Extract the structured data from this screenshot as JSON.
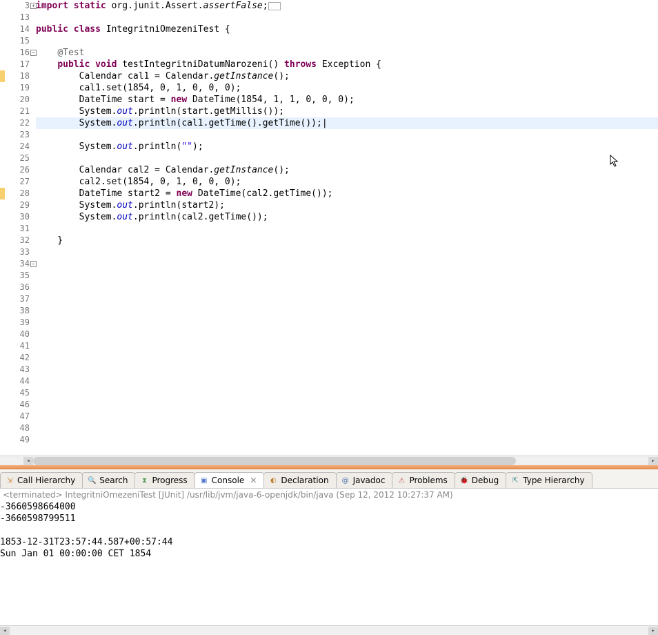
{
  "editor": {
    "lines": [
      {
        "n": "3",
        "fold": "plus",
        "tokens": [
          {
            "t": "import static ",
            "c": "kw"
          },
          {
            "t": "org.junit.Assert."
          },
          {
            "t": "assertFalse",
            "c": "ital"
          },
          {
            "t": ";"
          },
          {
            "t": "[]",
            "c": "hint"
          }
        ]
      },
      {
        "n": "13",
        "tokens": []
      },
      {
        "n": "14",
        "tokens": [
          {
            "t": "public class ",
            "c": "kw"
          },
          {
            "t": "IntegritniOmezeniTest {"
          }
        ]
      },
      {
        "n": "15",
        "tokens": []
      },
      {
        "n": "16",
        "fold": "minus",
        "tokens": [
          {
            "t": "    "
          },
          {
            "t": "@Test",
            "c": "ann"
          }
        ]
      },
      {
        "n": "17",
        "tokens": [
          {
            "t": "    "
          },
          {
            "t": "public void ",
            "c": "kw"
          },
          {
            "t": "testIntegritniDatumNarozeni() "
          },
          {
            "t": "throws ",
            "c": "kw"
          },
          {
            "t": "Exception {"
          }
        ]
      },
      {
        "n": "18",
        "tokens": [
          {
            "t": "        Calendar cal1 = Calendar."
          },
          {
            "t": "getInstance",
            "c": "ital"
          },
          {
            "t": "();"
          }
        ]
      },
      {
        "n": "19",
        "tokens": [
          {
            "t": "        cal1.set(1854, 0, 1, 0, 0, 0);"
          }
        ]
      },
      {
        "n": "20",
        "tokens": [
          {
            "t": "        DateTime start = "
          },
          {
            "t": "new ",
            "c": "kw"
          },
          {
            "t": "DateTime(1854, 1, 1, 0, 0, 0);"
          }
        ]
      },
      {
        "n": "21",
        "tokens": [
          {
            "t": "        System."
          },
          {
            "t": "out",
            "c": "fld"
          },
          {
            "t": ".println(start.getMillis());"
          }
        ]
      },
      {
        "n": "22",
        "hl": true,
        "tokens": [
          {
            "t": "        System."
          },
          {
            "t": "out",
            "c": "fld"
          },
          {
            "t": ".println(cal1.getTime().getTime());"
          },
          {
            "t": "|",
            "c": "cursor"
          }
        ]
      },
      {
        "n": "23",
        "tokens": []
      },
      {
        "n": "24",
        "tokens": [
          {
            "t": "        System."
          },
          {
            "t": "out",
            "c": "fld"
          },
          {
            "t": ".println("
          },
          {
            "t": "\"\"",
            "c": "str"
          },
          {
            "t": ");"
          }
        ]
      },
      {
        "n": "25",
        "tokens": []
      },
      {
        "n": "26",
        "tokens": [
          {
            "t": "        Calendar cal2 = Calendar."
          },
          {
            "t": "getInstance",
            "c": "ital"
          },
          {
            "t": "();"
          }
        ]
      },
      {
        "n": "27",
        "tokens": [
          {
            "t": "        cal2.set(1854, 0, 1, 0, 0, 0);"
          }
        ]
      },
      {
        "n": "28",
        "tokens": [
          {
            "t": "        DateTime start2 = "
          },
          {
            "t": "new ",
            "c": "kw"
          },
          {
            "t": "DateTime(cal2.getTime());"
          }
        ]
      },
      {
        "n": "29",
        "tokens": [
          {
            "t": "        System."
          },
          {
            "t": "out",
            "c": "fld"
          },
          {
            "t": ".println(start2);"
          }
        ]
      },
      {
        "n": "30",
        "tokens": [
          {
            "t": "        System."
          },
          {
            "t": "out",
            "c": "fld"
          },
          {
            "t": ".println(cal2.getTime());"
          }
        ]
      },
      {
        "n": "31",
        "tokens": []
      },
      {
        "n": "32",
        "tokens": [
          {
            "t": "    }"
          }
        ]
      },
      {
        "n": "33",
        "tokens": []
      },
      {
        "n": "34",
        "fold": "minus",
        "tokens": []
      },
      {
        "n": "35",
        "tokens": []
      },
      {
        "n": "36",
        "tokens": []
      },
      {
        "n": "37",
        "tokens": []
      },
      {
        "n": "38",
        "tokens": []
      },
      {
        "n": "39",
        "tokens": []
      },
      {
        "n": "40",
        "tokens": []
      },
      {
        "n": "41",
        "tokens": []
      },
      {
        "n": "42",
        "tokens": []
      },
      {
        "n": "43",
        "tokens": []
      },
      {
        "n": "44",
        "tokens": []
      },
      {
        "n": "45",
        "tokens": []
      },
      {
        "n": "46",
        "tokens": []
      },
      {
        "n": "47",
        "tokens": []
      },
      {
        "n": "48",
        "tokens": []
      },
      {
        "n": "49",
        "tokens": []
      }
    ]
  },
  "tabs": [
    {
      "icon": "hierarchy",
      "color": "#c77d2e",
      "label": "Call Hierarchy"
    },
    {
      "icon": "search",
      "color": "#d9a440",
      "label": "Search"
    },
    {
      "icon": "progress",
      "color": "#5a9e5a",
      "label": "Progress"
    },
    {
      "icon": "console",
      "color": "#5577cc",
      "label": "Console",
      "active": true,
      "closable": true
    },
    {
      "icon": "declaration",
      "color": "#c08030",
      "label": "Declaration"
    },
    {
      "icon": "javadoc",
      "color": "#4a6fb0",
      "label": "Javadoc"
    },
    {
      "icon": "problems",
      "color": "#c05050",
      "label": "Problems"
    },
    {
      "icon": "debug",
      "color": "#6a9a3a",
      "label": "Debug"
    },
    {
      "icon": "type-hierarchy",
      "color": "#3a8a8a",
      "label": "Type Hierarchy"
    }
  ],
  "console": {
    "header": "<terminated> IntegritniOmezeniTest [JUnit] /usr/lib/jvm/java-6-openjdk/bin/java (Sep 12, 2012 10:27:37 AM)",
    "lines": [
      "-3660598664000",
      "-3660598799511",
      "",
      "1853-12-31T23:57:44.587+00:57:44",
      "Sun Jan 01 00:00:00 CET 1854"
    ]
  }
}
